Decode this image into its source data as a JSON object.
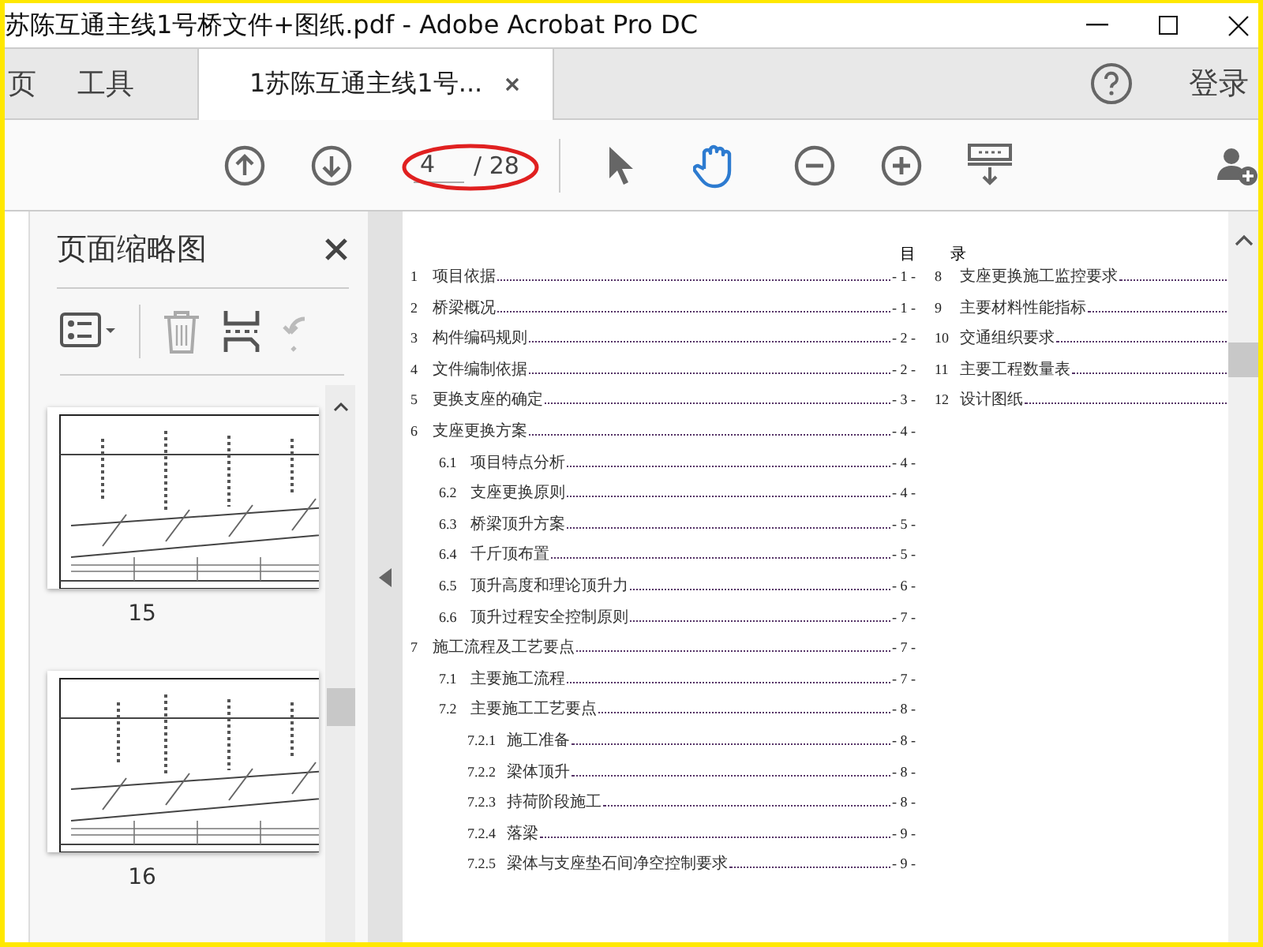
{
  "window": {
    "title": "苏陈互通主线1号桥文件+图纸.pdf - Adobe Acrobat Pro DC"
  },
  "tabs": [
    {
      "label": "页",
      "selected": false
    },
    {
      "label": "工具",
      "selected": false
    },
    {
      "label": "1苏陈互通主线1号...",
      "selected": true
    }
  ],
  "account": {
    "sign_in": "登录"
  },
  "toolbar": {
    "page_field": {
      "value": "4"
    },
    "page_total": "/ 28",
    "tools": [
      {
        "kind": "select",
        "selected": false
      },
      {
        "kind": "hand",
        "selected": true
      }
    ]
  },
  "thumbnails_panel": {
    "title": "页面缩略图",
    "pages": [
      {
        "label": "15"
      },
      {
        "label": "16"
      }
    ]
  },
  "document": {
    "heading": [
      "目",
      "录"
    ],
    "toc_left": [
      {
        "number": "1",
        "title": "项目依据",
        "page": "- 1 -"
      },
      {
        "number": "2",
        "title": "桥梁概况",
        "page": "- 1 -"
      },
      {
        "number": "3",
        "title": "构件编码规则",
        "page": "- 2 -"
      },
      {
        "number": "4",
        "title": "文件编制依据",
        "page": "- 2 -"
      },
      {
        "number": "5",
        "title": "更换支座的确定",
        "page": "- 3 -"
      },
      {
        "number": "6",
        "title": "支座更换方案",
        "page": "- 4 -",
        "children": [
          {
            "number": "6.1",
            "title": "项目特点分析",
            "page": "- 4 -"
          },
          {
            "number": "6.2",
            "title": "支座更换原则",
            "page": "- 4 -"
          },
          {
            "number": "6.3",
            "title": "桥梁顶升方案",
            "page": "- 5 -"
          },
          {
            "number": "6.4",
            "title": "千斤顶布置",
            "page": "- 5 -"
          },
          {
            "number": "6.5",
            "title": "顶升高度和理论顶升力",
            "page": "- 6 -"
          },
          {
            "number": "6.6",
            "title": "顶升过程安全控制原则",
            "page": "- 7 -"
          }
        ]
      },
      {
        "number": "7",
        "title": "施工流程及工艺要点",
        "page": "- 7 -",
        "children": [
          {
            "number": "7.1",
            "title": "主要施工流程",
            "page": "- 7 -"
          },
          {
            "number": "7.2",
            "title": "主要施工工艺要点",
            "page": "- 8 -",
            "children": [
              {
                "number": "7.2.1",
                "title": "施工准备",
                "page": "- 8 -"
              },
              {
                "number": "7.2.2",
                "title": "梁体顶升",
                "page": "- 8 -"
              },
              {
                "number": "7.2.3",
                "title": "持荷阶段施工",
                "page": "- 8 -"
              },
              {
                "number": "7.2.4",
                "title": "落梁",
                "page": "- 9 -"
              },
              {
                "number": "7.2.5",
                "title": "梁体与支座垫石间净空控制要求",
                "page": "- 9 -"
              }
            ]
          }
        ]
      }
    ],
    "toc_right": [
      {
        "number": "8",
        "title": "支座更换施工监控要求"
      },
      {
        "number": "9",
        "title": "主要材料性能指标"
      },
      {
        "number": "10",
        "title": "交通组织要求"
      },
      {
        "number": "11",
        "title": "主要工程数量表"
      },
      {
        "number": "12",
        "title": "设计图纸"
      }
    ]
  }
}
